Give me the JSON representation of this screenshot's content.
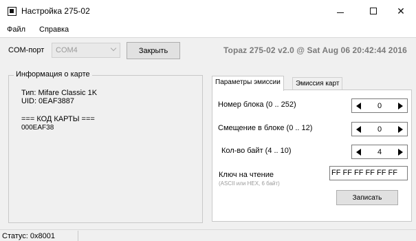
{
  "window": {
    "title": "Настройка 275-02"
  },
  "menu": {
    "items": [
      "Файл",
      "Справка"
    ]
  },
  "toolbar": {
    "com_label": "COM-порт",
    "com_value": "COM4",
    "close_button": "Закрыть",
    "version_text": "Topaz 275-02 v2.0 @ Sat Aug 06 20:42:44 2016"
  },
  "card_info": {
    "group_title": "Информация о карте",
    "type_line": "Тип: Mifare Classic 1K",
    "uid_line": "UID: 0EAF3887",
    "code_header": "=== КОД КАРТЫ ===",
    "code_value": "000EAF38"
  },
  "tabs": {
    "emission_params": "Параметры эмиссии",
    "card_emission": "Эмиссия карт"
  },
  "params": {
    "block_number": {
      "label": "Номер блока (0 .. 252)",
      "value": "0"
    },
    "block_offset": {
      "label": "Смещение в блоке (0 .. 12)",
      "value": "0"
    },
    "byte_count": {
      "label": "Кол-во байт (4 .. 10)",
      "value": "4"
    },
    "read_key": {
      "label": "Ключ на чтение",
      "hint": "(ASCII или HEX, 6 байт)",
      "value": "FF FF FF FF FF FF"
    },
    "write_button": "Записать"
  },
  "status": {
    "text": "Статус: 0x8001"
  }
}
